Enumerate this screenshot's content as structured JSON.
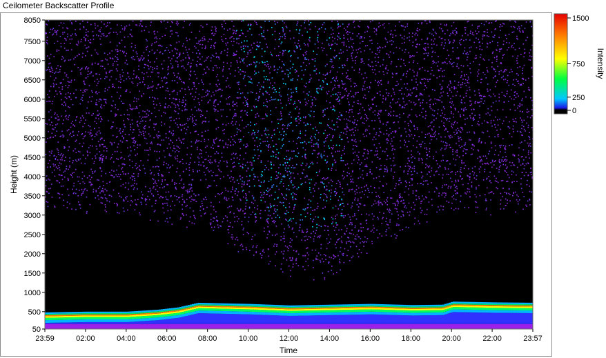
{
  "window": {
    "title": "Ceilometer Backscatter Profile"
  },
  "chart_data": {
    "type": "heatmap",
    "title": "Ceilometer Backscatter Profile",
    "xlabel": "Time",
    "ylabel": "Height (m)",
    "x_ticks": [
      "23:59",
      "02:00",
      "04:00",
      "06:00",
      "08:00",
      "10:00",
      "12:00",
      "14:00",
      "16:00",
      "18:00",
      "20:00",
      "22:00",
      "23:57"
    ],
    "y_ticks": [
      50,
      500,
      1000,
      1500,
      2000,
      2500,
      3000,
      3500,
      4000,
      4500,
      5000,
      5500,
      6000,
      6500,
      7000,
      7500,
      8050
    ],
    "ylim": [
      50,
      8050
    ],
    "colorbar": {
      "label": "Intensity",
      "ticks": [
        0,
        250,
        750,
        1500
      ],
      "range": [
        0,
        1500
      ],
      "colors": [
        "#000000",
        "#1a1ae6",
        "#00c8ff",
        "#00ff40",
        "#ffff00",
        "#ff8000",
        "#e60000"
      ]
    },
    "boundary_layer_height": {
      "time": [
        "00:00",
        "02:00",
        "04:00",
        "05:30",
        "06:30",
        "07:30",
        "10:00",
        "12:00",
        "14:00",
        "16:00",
        "18:00",
        "19:30",
        "20:00",
        "22:00",
        "23:57"
      ],
      "height": [
        400,
        420,
        420,
        470,
        530,
        650,
        620,
        580,
        600,
        620,
        590,
        600,
        680,
        660,
        650
      ]
    },
    "noise_floor_height": {
      "time": [
        "00:00",
        "04:00",
        "08:00",
        "10:00",
        "12:00",
        "14:00",
        "16:00",
        "20:00",
        "23:57"
      ],
      "height": [
        3500,
        3400,
        3000,
        2200,
        1800,
        1700,
        2600,
        3500,
        3500
      ]
    },
    "grid": false
  }
}
